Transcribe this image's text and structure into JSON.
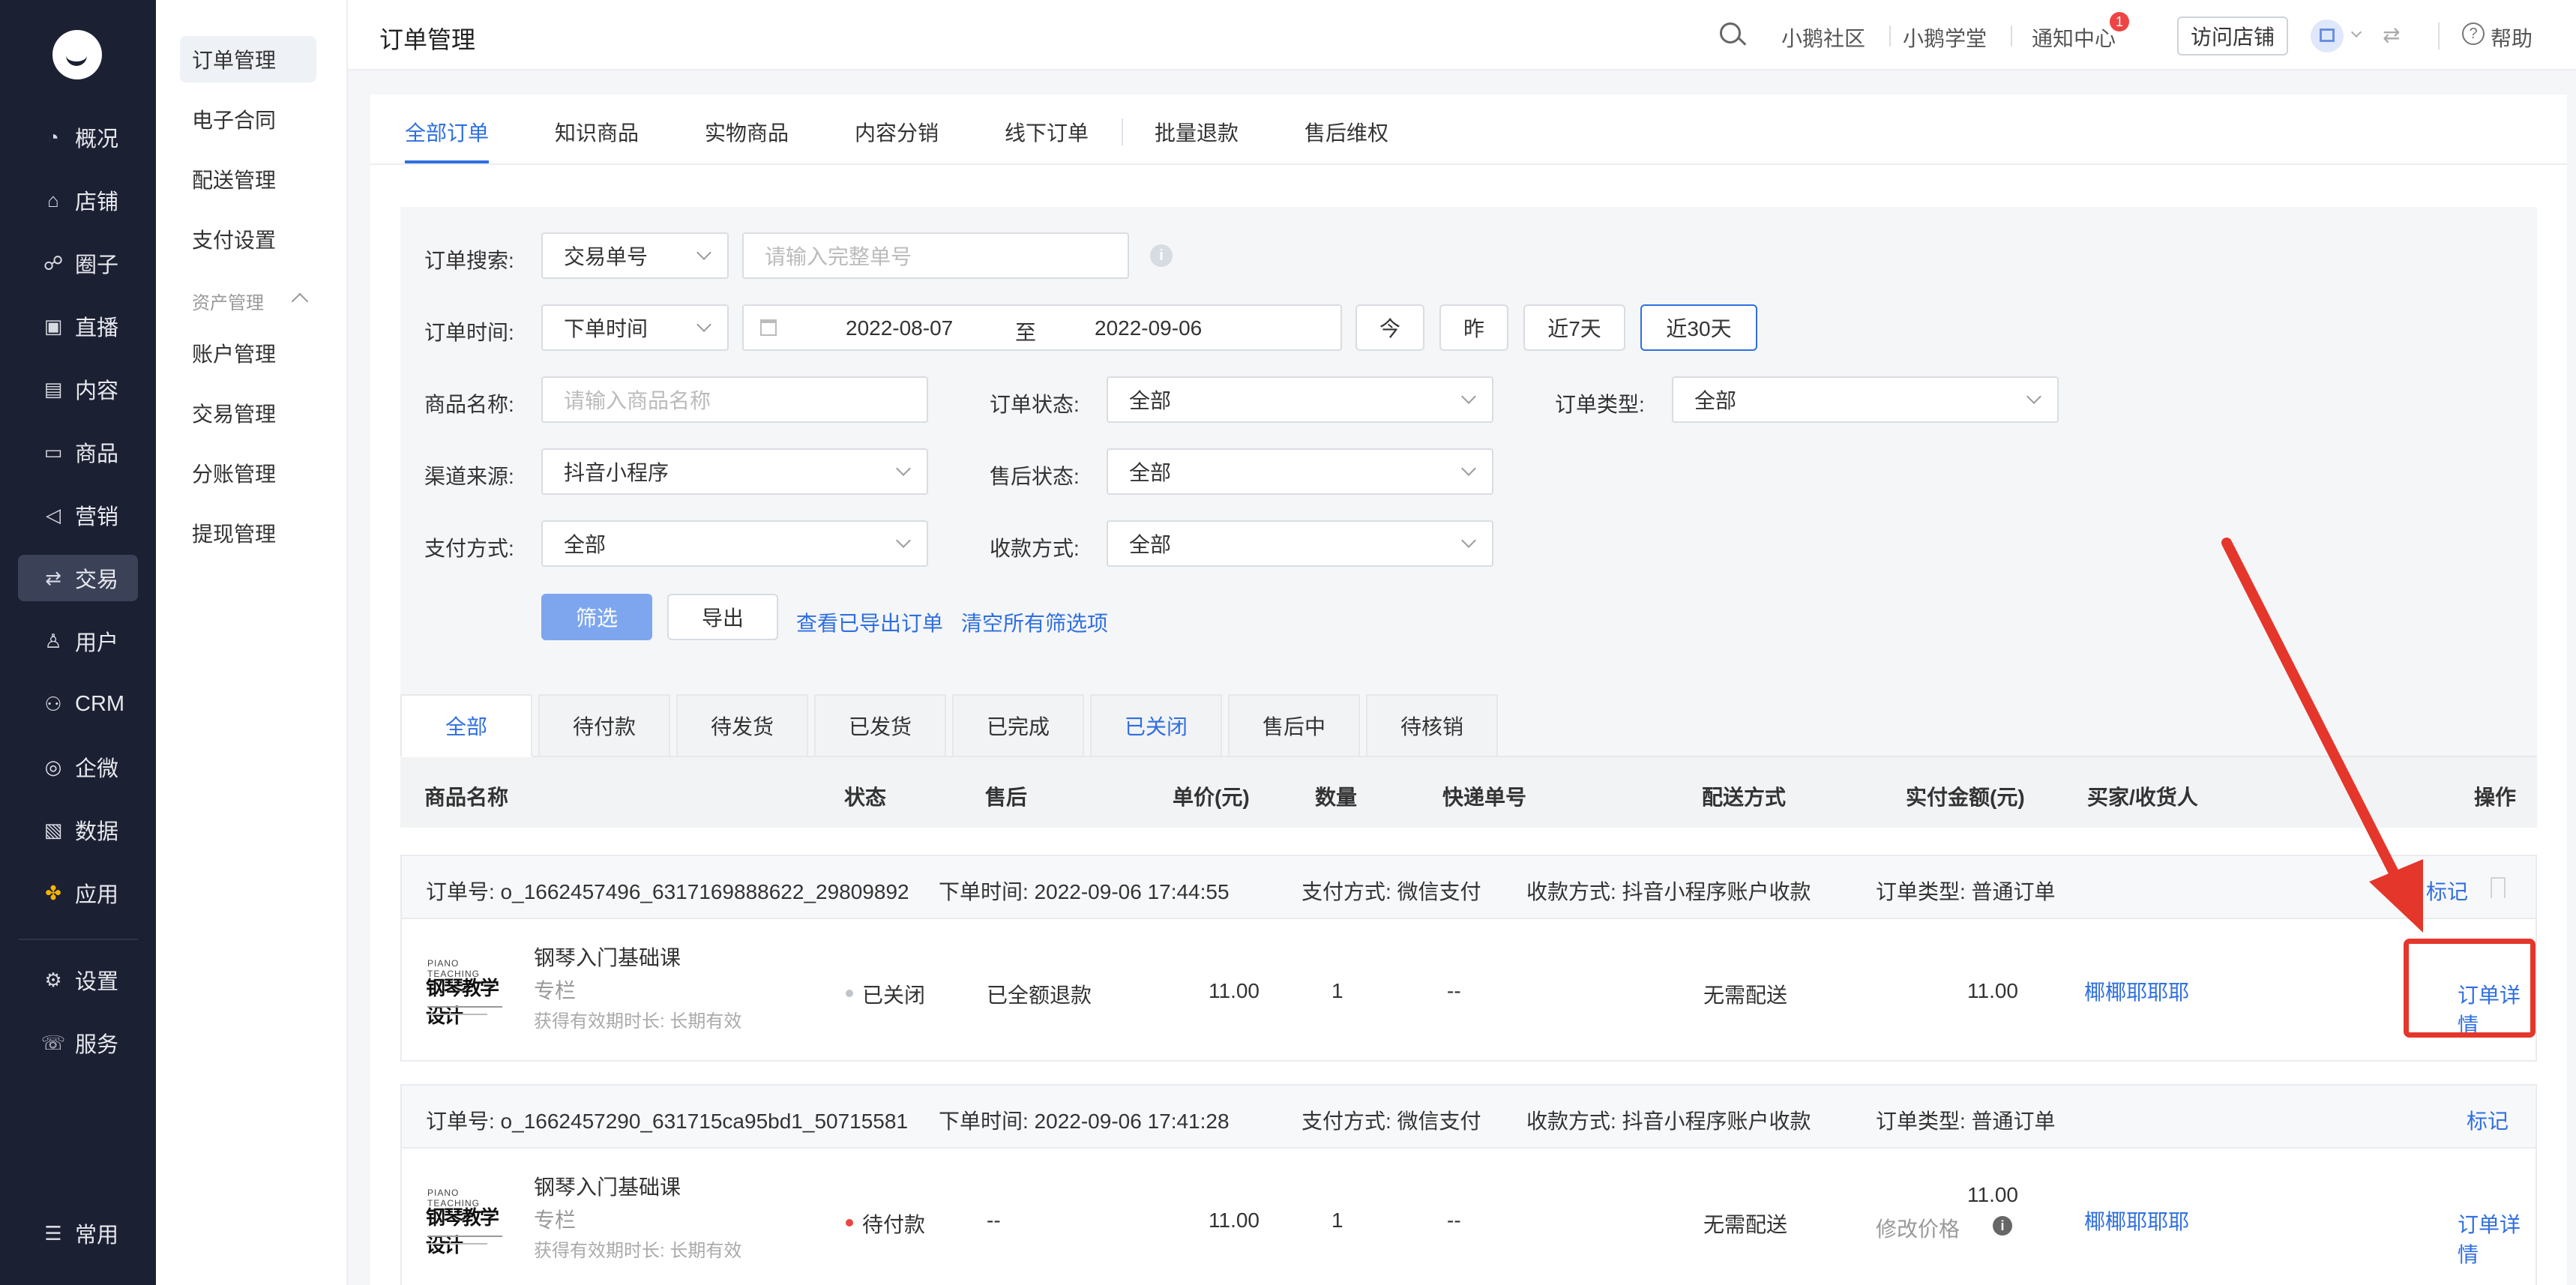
{
  "nav": {
    "items": [
      {
        "label": "概况",
        "icon": "pie-chart-icon"
      },
      {
        "label": "店铺",
        "icon": "store-icon"
      },
      {
        "label": "圈子",
        "icon": "group-icon"
      },
      {
        "label": "直播",
        "icon": "live-icon"
      },
      {
        "label": "内容",
        "icon": "document-icon"
      },
      {
        "label": "商品",
        "icon": "box-icon"
      },
      {
        "label": "营销",
        "icon": "megaphone-icon"
      },
      {
        "label": "交易",
        "icon": "exchange-icon"
      },
      {
        "label": "用户",
        "icon": "user-icon"
      },
      {
        "label": "CRM",
        "icon": "crm-icon"
      },
      {
        "label": "企微",
        "icon": "wechat-work-icon"
      },
      {
        "label": "数据",
        "icon": "chart-icon"
      },
      {
        "label": "应用",
        "icon": "apps-icon"
      },
      {
        "label": "设置",
        "icon": "gear-icon"
      },
      {
        "label": "服务",
        "icon": "service-icon"
      }
    ],
    "bottom": {
      "label": "常用",
      "icon": "list-icon"
    }
  },
  "submenu": {
    "items": [
      "订单管理",
      "电子合同",
      "配送管理",
      "支付设置"
    ],
    "group": "资产管理",
    "group_items": [
      "账户管理",
      "交易管理",
      "分账管理",
      "提现管理"
    ]
  },
  "header": {
    "title": "订单管理",
    "links": [
      "小鹅社区",
      "小鹅学堂",
      "通知中心"
    ],
    "notify_count": "1",
    "visit": "访问店铺",
    "help": "帮助"
  },
  "tabs": [
    "全部订单",
    "知识商品",
    "实物商品",
    "内容分销",
    "线下订单",
    "批量退款",
    "售后维权"
  ],
  "filter": {
    "search_label": "订单搜索:",
    "search_type": "交易单号",
    "search_placeholder": "请输入完整单号",
    "time_label": "订单时间:",
    "time_type": "下单时间",
    "date_from": "2022-08-07",
    "date_to_sep": "至",
    "date_to": "2022-09-06",
    "quick": [
      "今",
      "昨",
      "近7天",
      "近30天"
    ],
    "product_label": "商品名称:",
    "product_placeholder": "请输入商品名称",
    "status_label": "订单状态:",
    "status_value": "全部",
    "type_label": "订单类型:",
    "type_value": "全部",
    "channel_label": "渠道来源:",
    "channel_value": "抖音小程序",
    "aftersale_label": "售后状态:",
    "aftersale_value": "全部",
    "pay_label": "支付方式:",
    "pay_value": "全部",
    "collect_label": "收款方式:",
    "collect_value": "全部",
    "btn_filter": "筛选",
    "btn_export": "导出",
    "link_exported": "查看已导出订单",
    "link_clear": "清空所有筛选项"
  },
  "status_tabs": [
    "全部",
    "待付款",
    "待发货",
    "已发货",
    "已完成",
    "已关闭",
    "售后中",
    "待核销"
  ],
  "columns": [
    "商品名称",
    "状态",
    "售后",
    "单价(元)",
    "数量",
    "快递单号",
    "配送方式",
    "实付金额(元)",
    "买家/收货人",
    "操作"
  ],
  "orders": [
    {
      "order_no": "订单号: o_1662457496_6317169888622_29809892",
      "time": "下单时间: 2022-09-06 17:44:55",
      "pay": "支付方式: 微信支付",
      "collect": "收款方式: 抖音小程序账户收款",
      "type": "订单类型: 普通订单",
      "mark": "标记",
      "thumb_top": "PIANO TEACHING",
      "thumb_main": "钢琴教学设计",
      "name": "钢琴入门基础课",
      "category": "专栏",
      "validity": "获得有效期时长: 长期有效",
      "status": "已关闭",
      "status_color": "#c0c4cc",
      "aftersale": "已全额退款",
      "price": "11.00",
      "qty": "1",
      "express": "--",
      "delivery": "无需配送",
      "paid": "11.00",
      "buyer": "椰椰耶耶耶",
      "action": "订单详情"
    },
    {
      "order_no": "订单号: o_1662457290_631715ca95bd1_50715581",
      "time": "下单时间: 2022-09-06 17:41:28",
      "pay": "支付方式: 微信支付",
      "collect": "收款方式: 抖音小程序账户收款",
      "type": "订单类型: 普通订单",
      "mark": "标记",
      "thumb_top": "PIANO TEACHING",
      "thumb_main": "钢琴教学设计",
      "name": "钢琴入门基础课",
      "category": "专栏",
      "validity": "获得有效期时长: 长期有效",
      "status": "待付款",
      "status_color": "#ee4444",
      "aftersale": "--",
      "price": "11.00",
      "qty": "1",
      "express": "--",
      "delivery": "无需配送",
      "paid": "11.00",
      "modify_price": "修改价格",
      "buyer": "椰椰耶耶耶",
      "action": "订单详情"
    }
  ],
  "colors": {
    "accent": "#2f6fe0",
    "nav_bg": "#1c2033",
    "annotation": "#e5362b"
  }
}
